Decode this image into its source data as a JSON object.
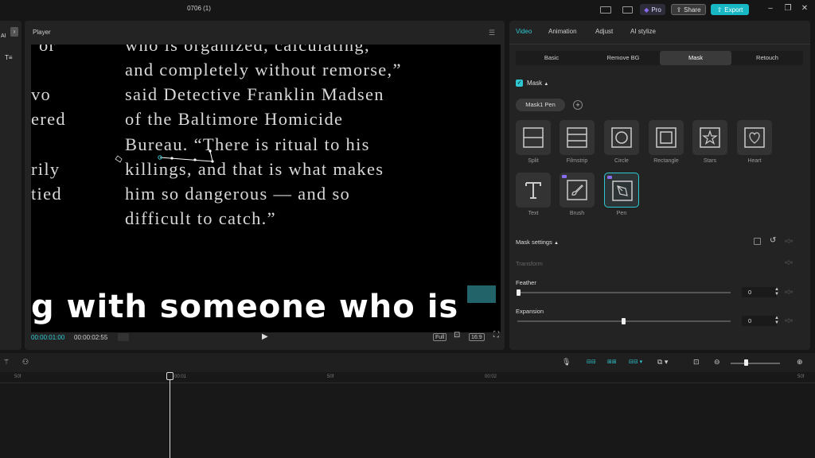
{
  "window": {
    "title": "0706 (1)"
  },
  "titlebar": {
    "pro_label": "Pro",
    "share_label": "Share",
    "export_label": "Export"
  },
  "left_panel": {
    "ai_label": "AI",
    "text_label": "T≡"
  },
  "player": {
    "title": "Player",
    "video_lines": [
      "who is organized, calculating,",
      "and completely without remorse,”",
      "said Detective Franklin Madsen",
      "of the Baltimore Homicide",
      "Bureau. “There is ritual to his",
      "killings, and that is what makes",
      "him so dangerous — and so",
      "difficult to catch.”"
    ],
    "left_fragments": [
      "or",
      "vo",
      "ered",
      "",
      "",
      "rily",
      "tied",
      ""
    ],
    "caption": "g with someone who is",
    "current_time": "00:00:01:00",
    "total_time": "00:00:02:55",
    "full_label": "Full",
    "ratio_label": "16:9"
  },
  "inspector": {
    "tabs": [
      "Video",
      "Animation",
      "Adjust",
      "AI stylize"
    ],
    "active_tab": "Video",
    "subtabs": [
      "Basic",
      "Remove BG",
      "Mask",
      "Retouch"
    ],
    "active_subtab": "Mask",
    "mask_section_label": "Mask",
    "mask_chip_label": "Mask1 Pen",
    "mask_tiles": [
      {
        "label": "Split",
        "icon": "split-icon"
      },
      {
        "label": "Filmstrip",
        "icon": "filmstrip-icon"
      },
      {
        "label": "Circle",
        "icon": "circle-icon"
      },
      {
        "label": "Rectangle",
        "icon": "rectangle-icon"
      },
      {
        "label": "Stars",
        "icon": "star-icon"
      },
      {
        "label": "Heart",
        "icon": "heart-icon"
      },
      {
        "label": "Text",
        "icon": "text-icon"
      },
      {
        "label": "Brush",
        "icon": "brush-icon"
      },
      {
        "label": "Pen",
        "icon": "pen-icon"
      }
    ],
    "active_tile": "Pen",
    "mask_settings_label": "Mask settings",
    "transform_label": "Transform",
    "feather_label": "Feather",
    "feather_value": "0",
    "expansion_label": "Expansion",
    "expansion_value": "0"
  },
  "timeline": {
    "ruler_ticks": [
      "50f",
      "00:01",
      "50f",
      "00:02",
      "50f"
    ]
  },
  "colors": {
    "accent": "#2fc8d2",
    "export": "#17b8c4",
    "pro": "#8a6cf0"
  }
}
